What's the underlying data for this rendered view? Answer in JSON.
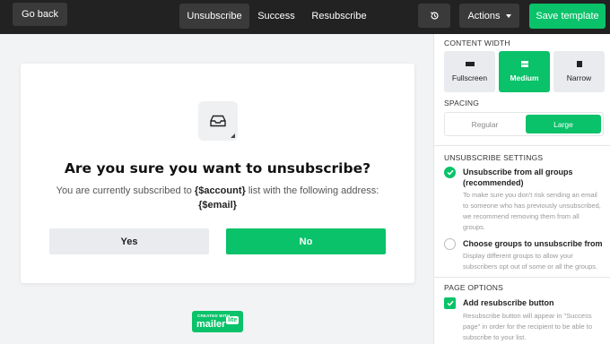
{
  "toolbar": {
    "go_back": "Go back",
    "tabs": [
      {
        "label": "Unsubscribe",
        "active": true
      },
      {
        "label": "Success",
        "active": false
      },
      {
        "label": "Resubscribe",
        "active": false
      }
    ],
    "history_icon": "history-icon",
    "actions": "Actions",
    "save": "Save template"
  },
  "page": {
    "icon": "inbox-icon",
    "headline": "Are you sure you want to unsubscribe?",
    "sub_prefix": "You are currently subscribed to ",
    "account_var": "{$account}",
    "sub_middle": " list with the following address:",
    "email_var": "{$email}",
    "yes": "Yes",
    "no": "No"
  },
  "badge": {
    "created_with": "CREATED WITH",
    "brand": "mailer",
    "lite": "lite"
  },
  "panel": {
    "content_width": {
      "label": "CONTENT WIDTH",
      "options": [
        {
          "label": "Fullscreen",
          "selected": false
        },
        {
          "label": "Medium",
          "selected": true
        },
        {
          "label": "Narrow",
          "selected": false
        }
      ]
    },
    "spacing": {
      "label": "SPACING",
      "regular": "Regular",
      "large": "Large",
      "selected": "Large"
    },
    "unsubscribe_settings": {
      "label": "UNSUBSCRIBE SETTINGS",
      "opt1_title_1": "Unsubscribe from all groups",
      "opt1_title_2": "(recommended)",
      "opt1_desc_1": "To make sure you don't risk sending an email",
      "opt1_desc_2": "to someone who has previously unsubscribed,",
      "opt1_desc_3": "we recommend removing them from all",
      "opt1_desc_4": "groups.",
      "opt2_title": "Choose groups to unsubscribe from",
      "opt2_desc_1": "Display different groups to allow your",
      "opt2_desc_2": "subscribers opt out of some or all the groups."
    },
    "page_options": {
      "label": "PAGE OPTIONS",
      "add_resub_title": "Add resubscribe button",
      "add_resub_checked": true,
      "desc_1": "Resubscribe button will appear in \"Success",
      "desc_2": "page\" in order for the recipient to be able to",
      "desc_3": "subscribe to your list."
    }
  },
  "colors": {
    "accent": "#09c269",
    "topbar": "#222222"
  }
}
